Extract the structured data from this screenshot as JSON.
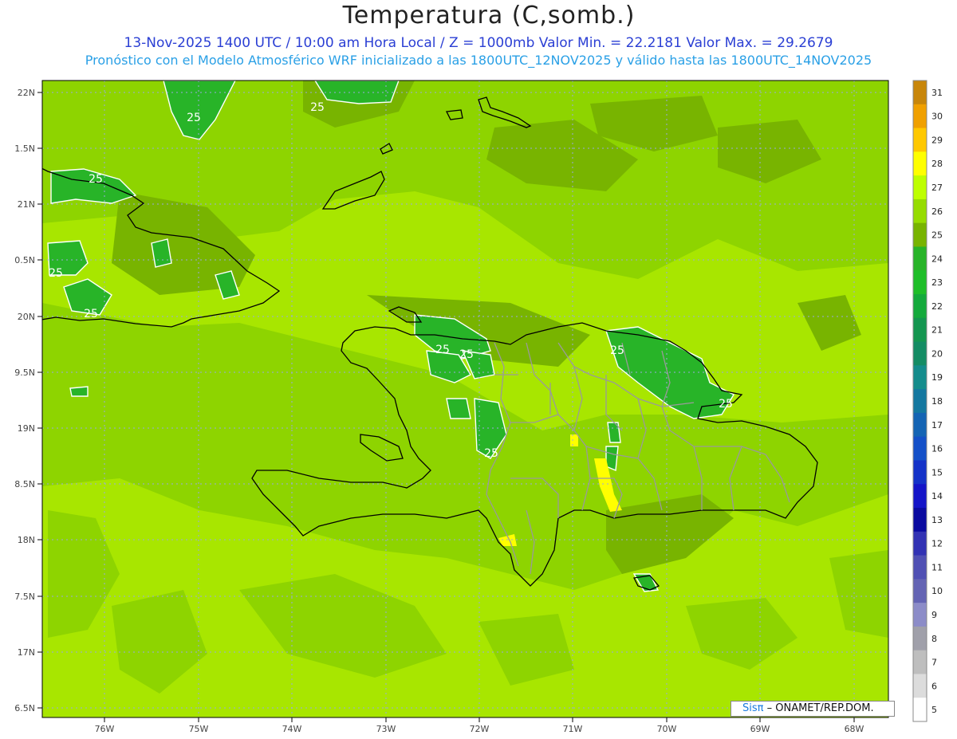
{
  "header": {
    "title": "Temperatura (C,somb.)",
    "subtitle1": "13-Nov-2025 1400 UTC / 10:00 am Hora Local / Z = 1000mb  Valor Min. = 22.2181  Valor Max. = 29.2679",
    "subtitle2": "Pronóstico con el Modelo Atmosférico WRF inicializado a las 1800UTC_12NOV2025 y válido hasta las  1800UTC_14NOV2025"
  },
  "axes": {
    "lat_labels": [
      "22N",
      "1.5N",
      "21N",
      "0.5N",
      "20N",
      "9.5N",
      "19N",
      "8.5N",
      "18N",
      "7.5N",
      "17N",
      "6.5N"
    ],
    "lon_labels": [
      "76W",
      "75W",
      "74W",
      "73W",
      "72W",
      "71W",
      "70W",
      "69W",
      "68W"
    ]
  },
  "contour_labels": [
    "25",
    "25",
    "25",
    "25",
    "25",
    "25",
    "25",
    "25",
    "25",
    "25"
  ],
  "colorbar": {
    "levels": [
      "31",
      "30",
      "29",
      "28",
      "27",
      "26",
      "25",
      "24",
      "23",
      "22",
      "21",
      "20",
      "19",
      "18",
      "17",
      "16",
      "15",
      "14",
      "13",
      "12",
      "11",
      "10",
      "9",
      "8",
      "7",
      "6",
      "5"
    ],
    "colors": [
      "#c8860a",
      "#f0a000",
      "#ffc800",
      "#ffff00",
      "#beff00",
      "#96dc00",
      "#78b400",
      "#28b428",
      "#1ebe28",
      "#14aa3c",
      "#149650",
      "#148c64",
      "#148c8c",
      "#1478a0",
      "#1464b4",
      "#1450c8",
      "#1432c8",
      "#1414c8",
      "#0a0aa0",
      "#3232b4",
      "#5050b4",
      "#6464b4",
      "#8c8cc8",
      "#a0a0aa",
      "#bebebe",
      "#dcdcdc",
      "#ffffff"
    ]
  },
  "credit": {
    "sis": "Sisπ",
    "rest": " – ONAMET/REP.DOM."
  }
}
